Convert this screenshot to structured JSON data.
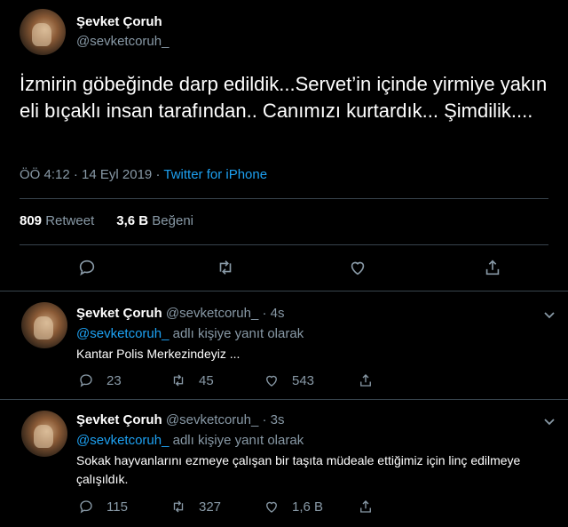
{
  "tweet": {
    "author_name": "Şevket Çoruh",
    "author_handle": "@sevketcoruh_",
    "text": "İzmirin göbeğinde darp edildik...Servet’in içinde yirmiye yakın eli bıçaklı insan tarafından.. Canımızı kurtardık... Şimdilik....",
    "time": "ÖÖ 4:12",
    "date": "14 Eyl 2019",
    "separator": "·",
    "source": "Twitter for iPhone",
    "retweet_count": "809",
    "retweet_label": "Retweet",
    "like_count": "3,6 B",
    "like_label": "Beğeni",
    "actions": [
      "reply-icon",
      "retweet-icon",
      "like-icon",
      "share-icon"
    ]
  },
  "replies": [
    {
      "author_name": "Şevket Çoruh",
      "author_handle": "@sevketcoruh_",
      "time": "4s",
      "separator": "·",
      "replying_mention": "@sevketcoruh_",
      "replying_suffix": "adlı kişiye yanıt olarak",
      "text": "Kantar Polis Merkezindeyiz ...",
      "reply_count": "23",
      "retweet_count": "45",
      "like_count": "543"
    },
    {
      "author_name": "Şevket Çoruh",
      "author_handle": "@sevketcoruh_",
      "time": "3s",
      "separator": "·",
      "replying_mention": "@sevketcoruh_",
      "replying_suffix": "adlı kişiye yanıt olarak",
      "text": "Sokak hayvanlarını ezmeye çalışan bir taşıta müdeale ettiğimiz için  linç edilmeye çalışıldık.",
      "reply_count": "115",
      "retweet_count": "327",
      "like_count": "1,6 B"
    }
  ],
  "colors": {
    "background": "#000000",
    "text": "#ffffff",
    "secondary": "#8899a6",
    "accent": "#1da1f2",
    "divider": "#38444d"
  }
}
